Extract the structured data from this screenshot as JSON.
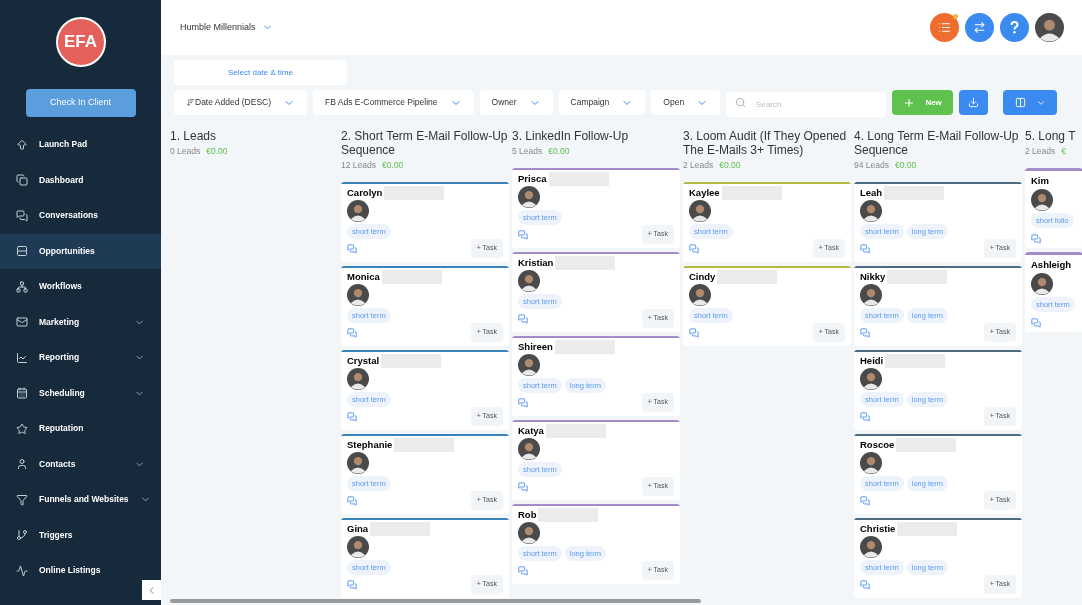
{
  "sidebar": {
    "logo": "EFA",
    "check_in": "Check In Client",
    "items": [
      {
        "label": "Launch Pad",
        "expandable": false,
        "selected": false
      },
      {
        "label": "Dashboard",
        "expandable": false,
        "selected": false
      },
      {
        "label": "Conversations",
        "expandable": false,
        "selected": false
      },
      {
        "label": "Opportunities",
        "expandable": false,
        "selected": true
      },
      {
        "label": "Workflows",
        "expandable": false,
        "selected": false
      },
      {
        "label": "Marketing",
        "expandable": true,
        "selected": false
      },
      {
        "label": "Reporting",
        "expandable": true,
        "selected": false
      },
      {
        "label": "Scheduling",
        "expandable": true,
        "selected": false
      },
      {
        "label": "Reputation",
        "expandable": false,
        "selected": false
      },
      {
        "label": "Contacts",
        "expandable": true,
        "selected": false
      },
      {
        "label": "Funnels and Websites",
        "expandable": true,
        "selected": false
      },
      {
        "label": "Triggers",
        "expandable": false,
        "selected": false
      },
      {
        "label": "Online Listings",
        "expandable": false,
        "selected": false
      }
    ]
  },
  "header": {
    "account": "Humble Millennials",
    "notification": true
  },
  "toolbar": {
    "date": "Select date & time",
    "sort": "Date Added (DESC)",
    "pipeline": "FB Ads E-Commerce Pipeline",
    "owner": "Owner",
    "campaign": "Campaign",
    "status": "Open",
    "search": {
      "placeholder": "Search"
    },
    "new": "New"
  },
  "columns": [
    {
      "title": "1. Leads",
      "count": "0 Leads",
      "value": "€0.00"
    },
    {
      "title": "2. Short Term E-Mail Follow-Up Sequence",
      "count": "12 Leads",
      "value": "€0.00",
      "color": "#3b82b6",
      "cards": [
        {
          "name": "Carolyn",
          "tags": [
            "short term"
          ],
          "task": "+ Task"
        },
        {
          "name": "Monica",
          "tags": [
            "short term"
          ],
          "task": "+ Task"
        },
        {
          "name": "Crystal",
          "tags": [
            "short term"
          ],
          "task": "+ Task"
        },
        {
          "name": "Stephanie",
          "tags": [
            "short term"
          ],
          "task": "+ Task"
        },
        {
          "name": "Gina",
          "tags": [
            "short term"
          ],
          "task": "+ Task"
        }
      ]
    },
    {
      "title": "3. LinkedIn Follow-Up",
      "count": "5 Leads",
      "value": "€0.00",
      "color": "#a48bc9",
      "cards": [
        {
          "name": "Prisca",
          "tags": [
            "short term"
          ],
          "task": "+ Task"
        },
        {
          "name": "Kristian",
          "tags": [
            "short term"
          ],
          "task": "+ Task"
        },
        {
          "name": "Shireen",
          "tags": [
            "short term",
            "long term"
          ],
          "task": "+ Task"
        },
        {
          "name": "Katya",
          "tags": [
            "short term"
          ],
          "task": "+ Task"
        },
        {
          "name": "Rob",
          "tags": [
            "short term",
            "long term"
          ],
          "task": "+ Task"
        }
      ]
    },
    {
      "title": "3. Loom Audit (If They Opened The E-Mails 3+ Times)",
      "count": "2 Leads",
      "value": "€0.00",
      "color": "#b5b840",
      "cards": [
        {
          "name": "Kaylee",
          "tags": [
            "short term"
          ],
          "task": "+ Task"
        },
        {
          "name": "Cindy",
          "tags": [
            "short term"
          ],
          "task": "+ Task"
        }
      ]
    },
    {
      "title": "4. Long Term E-Mail Follow-Up Sequence",
      "count": "94 Leads",
      "value": "€0.00",
      "color": "#4d6b80",
      "cards": [
        {
          "name": "Leah",
          "tags": [
            "short term",
            "long term"
          ],
          "task": "+ Task"
        },
        {
          "name": "Nikky",
          "tags": [
            "short term",
            "long term"
          ],
          "task": "+ Task"
        },
        {
          "name": "Heidi",
          "tags": [
            "short term",
            "long term"
          ],
          "task": "+ Task"
        },
        {
          "name": "Roscoe",
          "tags": [
            "short term",
            "long term"
          ],
          "task": "+ Task"
        },
        {
          "name": "Christie",
          "tags": [
            "short term",
            "long term"
          ],
          "task": "+ Task"
        }
      ]
    },
    {
      "title": "5. Long T",
      "count": "2 Leads",
      "value": "€",
      "color": "#a48bc9",
      "cards": [
        {
          "name": "Kim",
          "tags": [
            "short follo"
          ]
        },
        {
          "name": "Ashleigh",
          "tags": [
            "short term"
          ]
        }
      ]
    }
  ]
}
